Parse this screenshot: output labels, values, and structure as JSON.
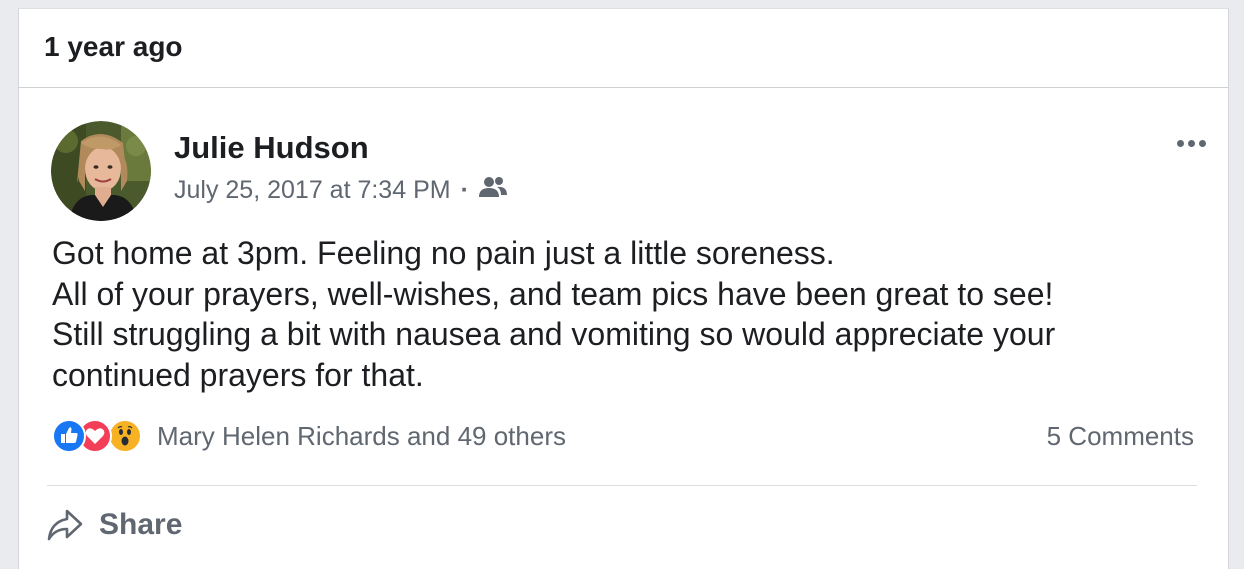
{
  "memory": {
    "header_title": "1 year ago"
  },
  "post": {
    "author": "Julie Hudson",
    "timestamp": "July 25, 2017 at 7:34 PM",
    "separator": "·",
    "audience_icon": "friends-icon",
    "more_icon": "more-options-icon",
    "avatar_icon": "profile-photo",
    "body_lines": [
      "Got home at 3pm. Feeling no pain just a little soreness.",
      "All of your prayers, well-wishes, and team pics have been great to see!",
      "Still struggling a bit with nausea and vomiting so would appreciate your",
      "continued prayers for that."
    ],
    "reactions": {
      "icons": [
        "like-icon",
        "love-icon",
        "wow-icon"
      ],
      "colors": {
        "like": "#1877f2",
        "love": "#f33e58",
        "wow": "#f7b125"
      },
      "summary": "Mary Helen Richards and 49 others"
    },
    "comments_count": "5 Comments",
    "actions": {
      "share_label": "Share",
      "share_icon": "share-arrow-icon"
    }
  }
}
